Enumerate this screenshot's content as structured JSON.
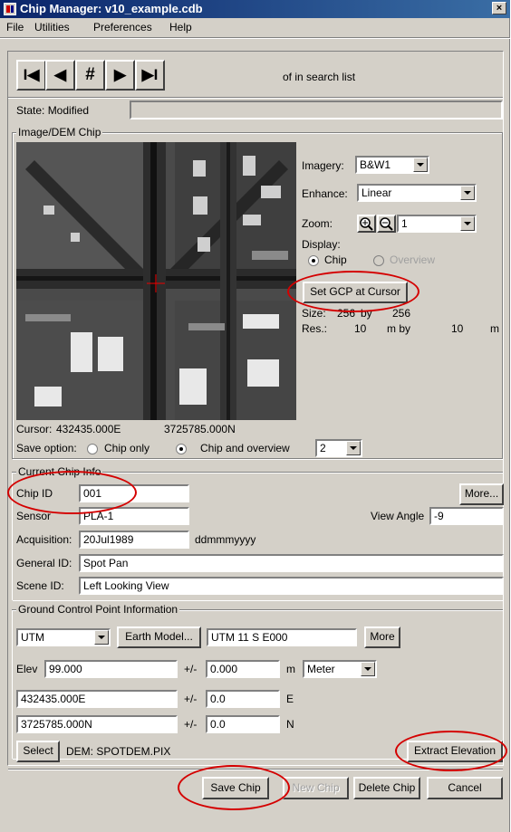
{
  "window": {
    "title": "Chip Manager: v10_example.cdb",
    "close_glyph": "×"
  },
  "menu": [
    "File",
    "Utilities",
    "Preferences",
    "Help"
  ],
  "nav": {
    "first": "I◀",
    "prev": "◀",
    "goto": "#",
    "next": "▶",
    "last": "▶I",
    "search_text": "of  in search list"
  },
  "state": {
    "label": "State: Modified",
    "value": ""
  },
  "image_group": {
    "title": "Image/DEM Chip"
  },
  "imagery": {
    "label": "Imagery:",
    "value": "B&W1"
  },
  "enhance": {
    "label": "Enhance:",
    "value": "Linear"
  },
  "zoom": {
    "label": "Zoom:",
    "value": "1"
  },
  "display": {
    "label": "Display:",
    "chip": "Chip",
    "overview": "Overview",
    "selected": "Chip"
  },
  "set_gcp": "Set GCP at Cursor",
  "size": {
    "label": "Size:",
    "w": "256",
    "by": "by",
    "h": "256"
  },
  "res": {
    "label": "Res.:",
    "x": "10",
    "unit1": "m  by",
    "y": "10",
    "unit2": "m"
  },
  "cursor": {
    "label": "Cursor:",
    "e": "432435.000E",
    "n": "3725785.000N"
  },
  "save_option": {
    "label": "Save option:",
    "chip_only": "Chip only",
    "chip_overview": "Chip and overview",
    "selected": "Chip and overview",
    "level": "2"
  },
  "chip_info": {
    "title": "Current Chip Info",
    "chip_id_label": "Chip ID",
    "chip_id": "001",
    "more": "More...",
    "sensor_label": "Sensor",
    "sensor": "PLA-1",
    "view_angle_label": "View Angle",
    "view_angle": "-9",
    "acq_label": "Acquisition:",
    "acq": "20Jul1989",
    "acq_fmt": "ddmmmyyyy",
    "general_label": "General ID:",
    "general": "Spot Pan",
    "scene_label": "Scene ID:",
    "scene": "Left Looking View"
  },
  "gcp": {
    "title": "Ground Control Point Information",
    "proj": "UTM",
    "earth_model": "Earth Model...",
    "proj_string": "UTM    11 S E000",
    "more": "More",
    "elev_label": "Elev",
    "elev": "99.000",
    "pm": "+/-",
    "elev_err": "0.000",
    "elev_unit": "m",
    "elev_units_select": "Meter",
    "easting": "432435.000E",
    "e_err": "0.0",
    "e_label": "E",
    "northing": "3725785.000N",
    "n_err": "0.0",
    "n_label": "N",
    "select": "Select",
    "dem": "DEM:  SPOTDEM.PIX",
    "extract": "Extract Elevation"
  },
  "buttons": {
    "save": "Save Chip",
    "new": "New Chip",
    "delete": "Delete Chip",
    "cancel": "Cancel"
  },
  "colors": {
    "title_bar": "#0a246a",
    "highlight_ovals": "#d40000",
    "window_bg": "#d4d0c8"
  }
}
